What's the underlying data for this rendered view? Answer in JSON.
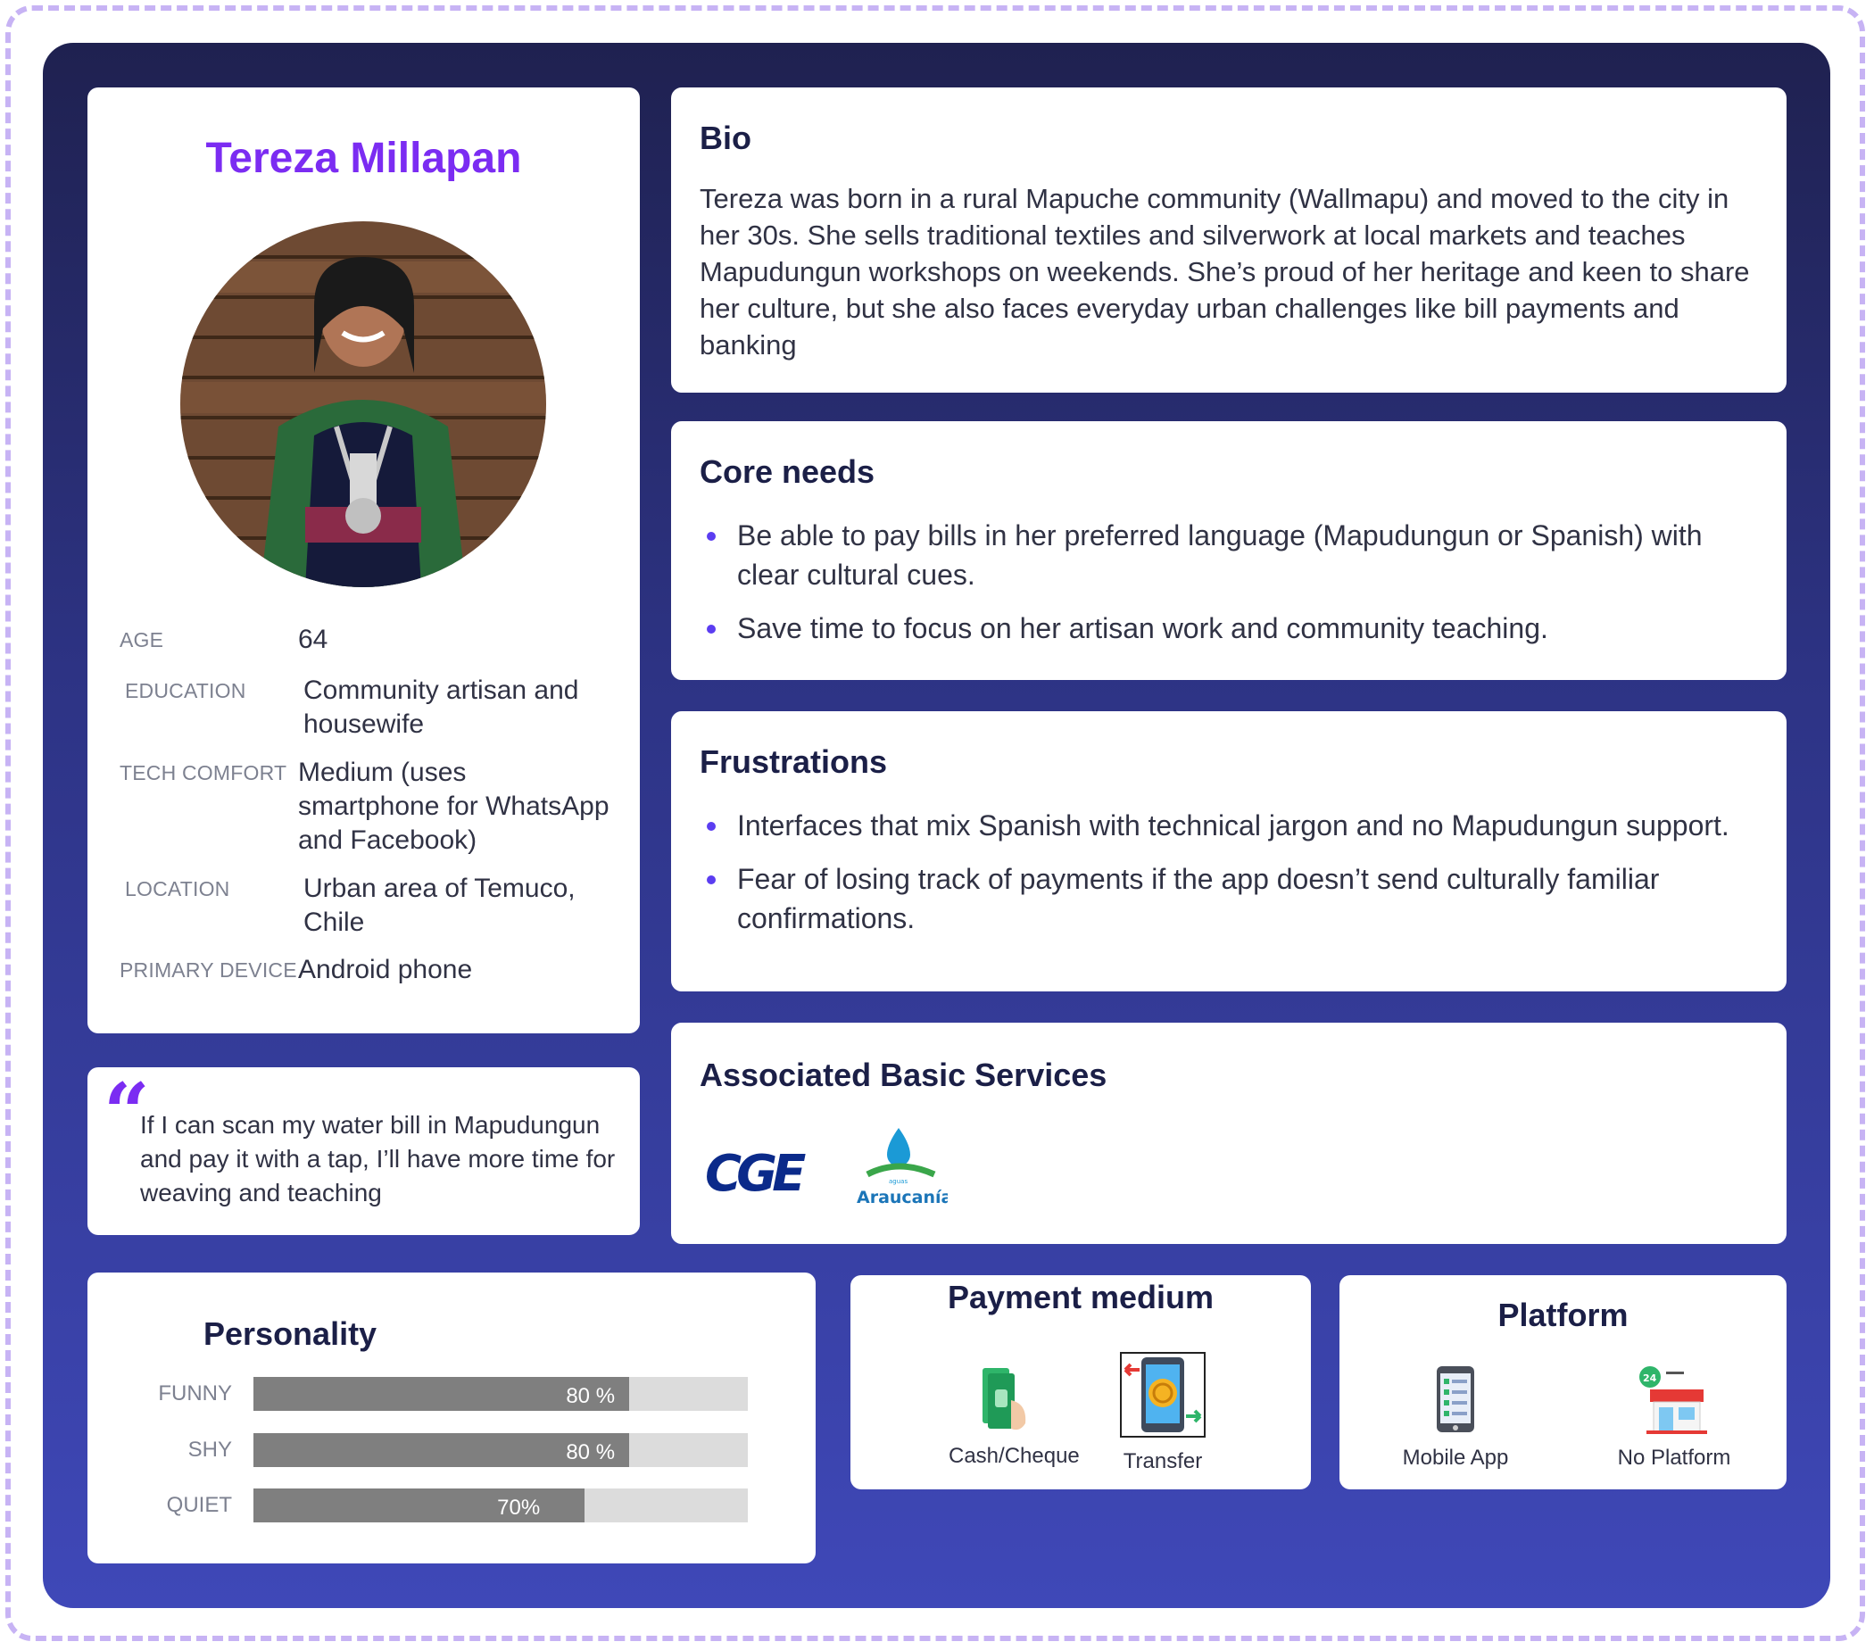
{
  "profile": {
    "name": "Tereza Millapan",
    "avatar_alt": "photo",
    "rows": [
      {
        "label": "AGE",
        "value": "64"
      },
      {
        "label": "EDUCATION",
        "value": "Community artisan and housewife"
      },
      {
        "label": "TECH COMFORT",
        "value": "Medium (uses smartphone for WhatsApp and Facebook)"
      },
      {
        "label": "LOCATION",
        "value": "Urban area of Temuco, Chile"
      },
      {
        "label": "PRIMARY DEVICE",
        "value": "Android phone"
      }
    ]
  },
  "quote": {
    "text": "If I can scan my water bill in Mapudungun and pay it with a tap, I’ll have more time for weaving and teaching"
  },
  "bio": {
    "title": "Bio",
    "text": "Tereza was born in a rural Mapuche community (Wallmapu) and moved to the city in her 30s. She sells traditional textiles and silverwork at local markets and teaches Mapudungun workshops on weekends. She’s proud of her heritage and keen to share her culture, but she also faces everyday urban challenges like bill payments and banking"
  },
  "core_needs": {
    "title": "Core needs",
    "items": [
      "Be able to pay bills in her preferred language (Mapudungun or Spanish) with clear cultural cues.",
      "Save time to focus on her artisan work and community teaching."
    ]
  },
  "frustrations": {
    "title": "Frustrations",
    "items": [
      "Interfaces that mix Spanish with technical jargon and no Mapudungun support.",
      "Fear of losing track of payments if the app doesn’t send culturally familiar confirmations."
    ]
  },
  "services": {
    "title": "Associated Basic Services",
    "logos": [
      {
        "name": "cge-logo",
        "text": "CGE"
      },
      {
        "name": "aguas-araucania-logo",
        "text": "Araucanía",
        "small_text": "aguas"
      }
    ]
  },
  "personality": {
    "title": "Personality",
    "traits": [
      {
        "label": "FUNNY",
        "value": 0.76,
        "pct_label": "80 %"
      },
      {
        "label": "SHY",
        "value": 0.76,
        "pct_label": "80 %"
      },
      {
        "label": "QUIET",
        "value": 0.67,
        "pct_label": "70%"
      }
    ]
  },
  "payment_medium": {
    "title": "Payment medium",
    "items": [
      {
        "label": "Cash/Cheque",
        "icon": "cash-icon"
      },
      {
        "label": "Transfer",
        "icon": "transfer-phone-icon"
      }
    ]
  },
  "platform": {
    "title": "Platform",
    "items": [
      {
        "label": "Mobile App",
        "icon": "mobile-app-icon"
      },
      {
        "label": "No Platform",
        "icon": "store-24h-icon"
      }
    ]
  },
  "colors": {
    "accent": "#7b2cf2",
    "heading": "#1b1f47",
    "board_top": "#1f2150",
    "board_bottom": "#3f48b8",
    "bar_fill": "#7f7f7f",
    "bar_track": "#dcdcdc",
    "cge_blue": "#0b2a8a",
    "aguas_blue": "#1b9ad6",
    "aguas_green": "#3aa64a"
  }
}
